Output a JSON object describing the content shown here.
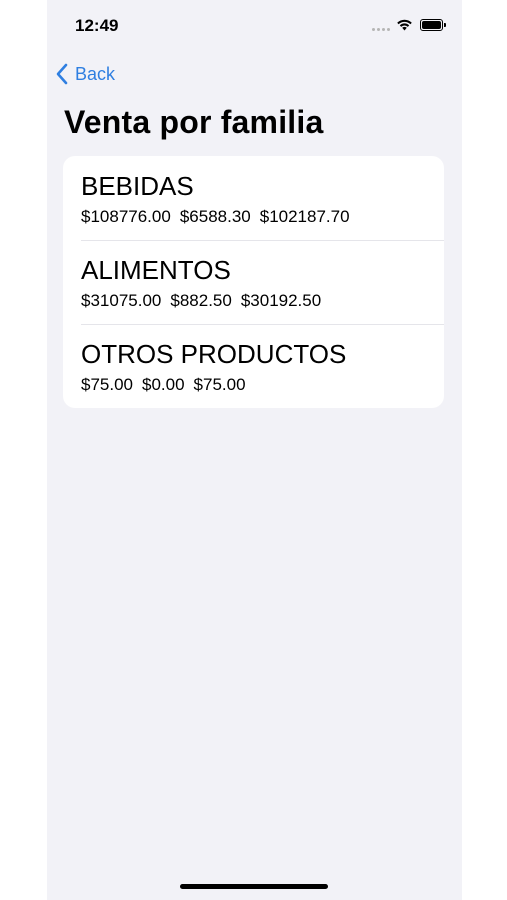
{
  "status_bar": {
    "time": "12:49"
  },
  "nav": {
    "back_label": "Back",
    "title": "Venta por familia"
  },
  "families": [
    {
      "name": "BEBIDAS",
      "values": [
        "$108776.00",
        "$6588.30",
        "$102187.70"
      ]
    },
    {
      "name": "ALIMENTOS",
      "values": [
        "$31075.00",
        "$882.50",
        "$30192.50"
      ]
    },
    {
      "name": "OTROS PRODUCTOS",
      "values": [
        "$75.00",
        "$0.00",
        "$75.00"
      ]
    }
  ],
  "colors": {
    "accent": "#2f7fe1",
    "background": "#f2f2f7",
    "card": "#ffffff",
    "separator": "#e5e5ea"
  },
  "icons": {
    "back": "chevron-left-icon",
    "wifi": "wifi-icon",
    "battery": "battery-icon",
    "signal": "signal-dots-icon"
  }
}
